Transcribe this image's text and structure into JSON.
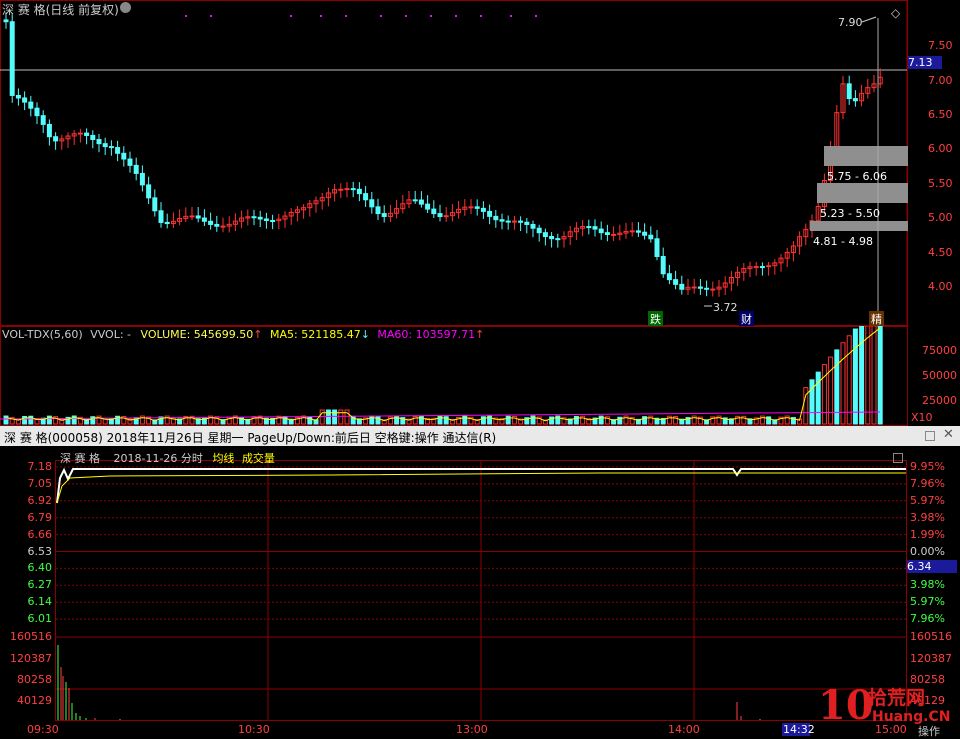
{
  "kline_header": {
    "title": "深 赛 格(日线 前复权)",
    "close_icon": "close-icon"
  },
  "kline_price_axis": [
    "7.50",
    "7.00",
    "6.50",
    "6.00",
    "5.50",
    "5.00",
    "4.50",
    "4.00"
  ],
  "kline_price_marker": "7.13",
  "kline_labels": {
    "high": "7.90",
    "low": "3.72",
    "range1": "5.75 - 6.06",
    "range2": "5.23 - 5.50",
    "range3": "4.81 - 4.98"
  },
  "kline_markers": {
    "die": "跌",
    "cai": "财",
    "jing": "精"
  },
  "vol_header": {
    "name": "VOL-TDX(5,60)",
    "vvol": "VVOL: -",
    "volume": "VOLUME: 545699.50",
    "ma5": "MA5: 521185.47",
    "ma60": "MA60: 103597.71"
  },
  "vol_axis": [
    "75000",
    "50000",
    "25000"
  ],
  "vol_multiplier": "X10",
  "minute_window_title": "深 赛 格(000058)  2018年11月26日 星期一  PageUp/Down:前后日 空格键:操作  通达信(R)",
  "minute_subheader": {
    "name": "深 赛 格",
    "date": "2018-11-26 分时",
    "avg": "均线",
    "vol": "成交量"
  },
  "minute_price_left": [
    "7.18",
    "7.05",
    "6.92",
    "6.79",
    "6.66",
    "6.53",
    "6.40",
    "6.27",
    "6.14",
    "6.01"
  ],
  "minute_pct_right": [
    "9.95%",
    "7.96%",
    "5.97%",
    "3.98%",
    "1.99%",
    "0.00%",
    "1.99%",
    "3.98%",
    "5.97%",
    "7.96%"
  ],
  "minute_price_marker": "6.34",
  "minute_vol_left": [
    "160516",
    "120387",
    "80258",
    "40129"
  ],
  "minute_vol_right": [
    "160516",
    "120387",
    "80258",
    "40129"
  ],
  "time_axis": [
    "09:30",
    "10:30",
    "13:00",
    "14:00",
    "15:00"
  ],
  "time_cursor": "14:32",
  "operate_label": "操作",
  "watermark": {
    "text": "拾荒网",
    "sub": "Huang.CN"
  },
  "colors": {
    "up": "#ff3232",
    "down": "#54fcfc",
    "grid": "#8b0000",
    "ma60": "#ff00ff",
    "ma5": "#ffff00"
  }
}
